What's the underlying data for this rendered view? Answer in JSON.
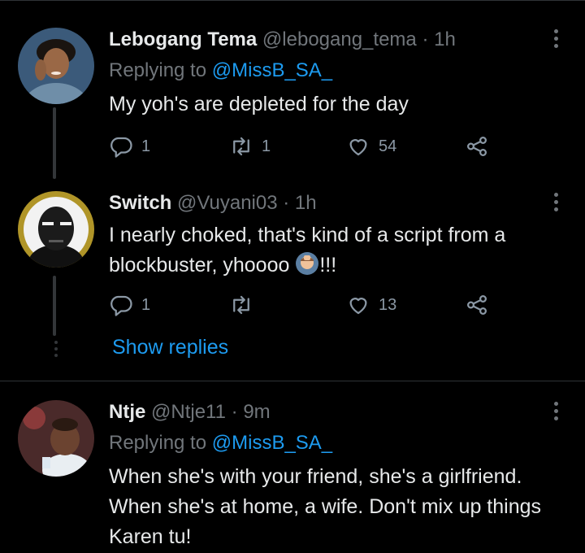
{
  "tweets": [
    {
      "name": "Lebogang Tema",
      "handle": "@lebogang_tema",
      "separator": "·",
      "time": "1h",
      "replying_prefix": "Replying to",
      "replying_to": "@MissB_SA_",
      "text": "My yoh's are depleted for the day",
      "reply_count": "1",
      "retweet_count": "1",
      "like_count": "54"
    },
    {
      "name": "Switch",
      "handle": "@Vuyani03",
      "separator": "·",
      "time": "1h",
      "text_part1": "I nearly choked, that's kind of a script from a blockbuster, yhoooo ",
      "text_part2": "!!!",
      "emoji": "person-facepalming-emoji",
      "reply_count": "1",
      "retweet_count": "",
      "like_count": "13"
    },
    {
      "name": "Ntje",
      "handle": "@Ntje11",
      "separator": "·",
      "time": "9m",
      "replying_prefix": "Replying to",
      "replying_to": "@MissB_SA_",
      "text": "When she's with your friend, she's a girlfriend. When she's at home, a wife. Don't mix up things Karen tu!"
    }
  ],
  "show_replies_label": "Show replies",
  "icons": {
    "reply": "reply-icon",
    "retweet": "retweet-icon",
    "like": "heart-icon",
    "share": "share-icon",
    "more": "more-options-icon"
  },
  "colors": {
    "background": "#000000",
    "text": "#e7e9ea",
    "secondary": "#71767b",
    "link": "#1d9bf0",
    "divider": "#2f3336"
  }
}
